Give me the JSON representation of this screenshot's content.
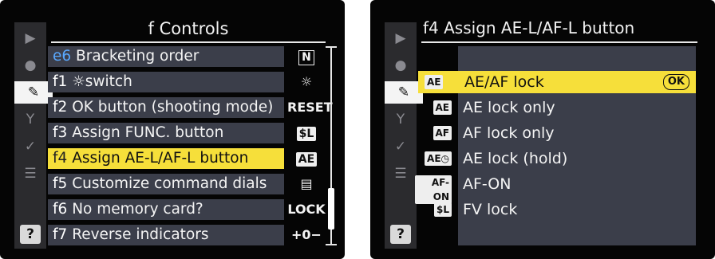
{
  "screen1": {
    "title": "f  Controls",
    "tabs": [
      {
        "name": "playback-icon",
        "glyph": "▶"
      },
      {
        "name": "shooting-icon",
        "glyph": "●"
      },
      {
        "name": "pencil-icon",
        "glyph": "✎"
      },
      {
        "name": "wrench-icon",
        "glyph": "Y"
      },
      {
        "name": "retouch-icon",
        "glyph": "✓"
      },
      {
        "name": "mymenu-icon",
        "glyph": "☰"
      }
    ],
    "help": "?",
    "rows": [
      {
        "code": "e6",
        "label": "Bracketing order",
        "value": "N"
      },
      {
        "code": "f1",
        "label": "☼switch",
        "value": "☼"
      },
      {
        "code": "f2",
        "label": "OK button (shooting mode)",
        "value": "RESET"
      },
      {
        "code": "f3",
        "label": "Assign FUNC. button",
        "value": "$L"
      },
      {
        "code": "f4",
        "label": "Assign AE-L/AF-L button",
        "value": "AE"
      },
      {
        "code": "f5",
        "label": "Customize command dials",
        "value": "▤"
      },
      {
        "code": "f6",
        "label": "No memory card?",
        "value": "LOCK"
      },
      {
        "code": "f7",
        "label": "Reverse indicators",
        "value": "+0−"
      }
    ]
  },
  "screen2": {
    "title": "f4 Assign AE-L/AF-L button",
    "help": "?",
    "ok_label": "OK",
    "options": [
      {
        "icon": "AE",
        "label": "AE/AF lock"
      },
      {
        "icon": "AE",
        "label": "AE lock only"
      },
      {
        "icon": "AF",
        "label": "AF lock only"
      },
      {
        "icon": "AE◷",
        "label": "AE lock (hold)"
      },
      {
        "icon": "AF-ON",
        "label": "AF-ON"
      },
      {
        "icon": "$L",
        "label": "FV lock"
      }
    ]
  }
}
